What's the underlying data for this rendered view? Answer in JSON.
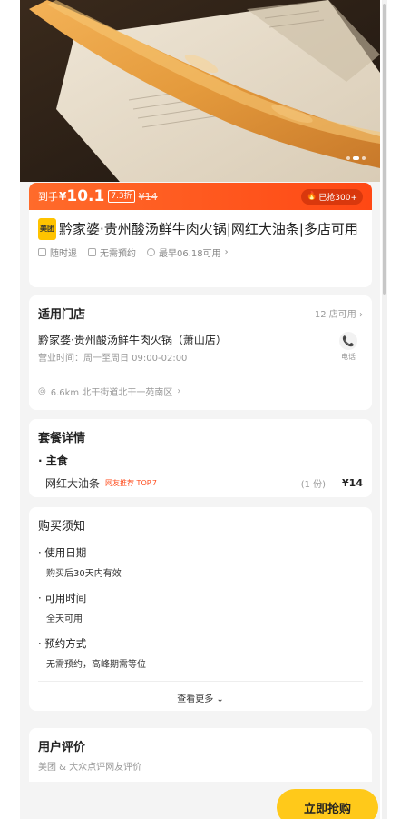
{
  "price": {
    "prefix": "到手",
    "currency": "¥",
    "value": "10.1",
    "discount": "7.3折",
    "original": "¥14",
    "sold": "已抢300+"
  },
  "deal": {
    "badge": "美团",
    "title": "黔家婆·贵州酸汤鲜牛肉火锅|网红大油条|多店可用",
    "tags": [
      "随时退",
      "无需预约",
      "最早06.18可用"
    ]
  },
  "store": {
    "section_title": "适用门店",
    "count": "12 店可用",
    "name": "黔家婆·贵州酸汤鲜牛肉火锅（萧山店）",
    "hours": "营业时间：周一至周日 09:00-02:00",
    "phone_label": "电话",
    "location": "6.6km  北干街道北干一苑南区"
  },
  "package": {
    "section_title": "套餐详情",
    "group": "主食",
    "item_name": "网红大油条",
    "item_tag": "网友推荐 TOP.7",
    "item_qty": "(1 份)",
    "item_price": "¥14"
  },
  "notice": {
    "section_title": "购买须知",
    "items": [
      {
        "label": "使用日期",
        "value": "购买后30天内有效"
      },
      {
        "label": "可用时间",
        "value": "全天可用"
      },
      {
        "label": "预约方式",
        "value": "无需预约，高峰期需等位"
      }
    ],
    "more": "查看更多"
  },
  "reviews": {
    "section_title": "用户评价",
    "subtitle": "美团 & 大众点评网友评价"
  },
  "cta": {
    "buy_label": "立即抢购"
  },
  "colors": {
    "accent": "#ff4814",
    "cta": "#ffc91a"
  }
}
